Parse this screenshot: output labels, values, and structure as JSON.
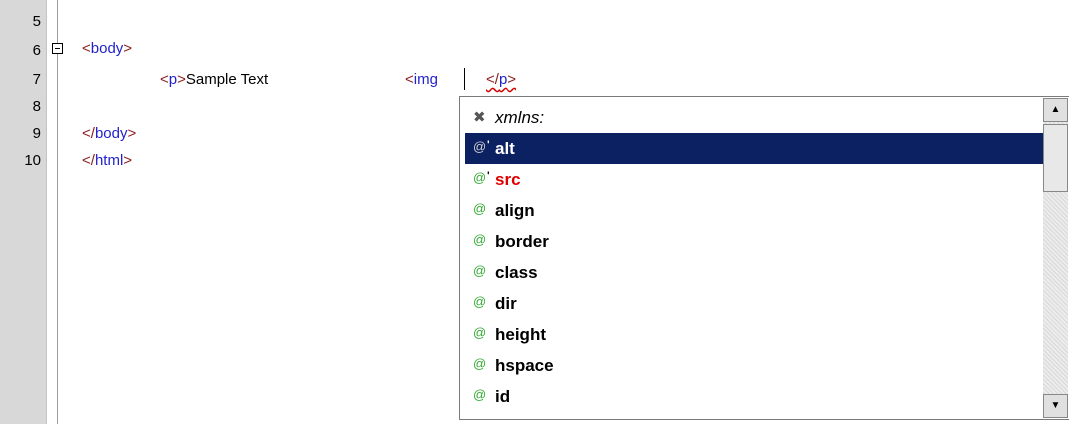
{
  "editor": {
    "line_numbers": [
      "5",
      "6",
      "7",
      "8",
      "9",
      "10"
    ],
    "lines": {
      "line6": {
        "open": "<",
        "tag": "body",
        "close": ">"
      },
      "line7": {
        "p_open": "<",
        "p_tag": "p",
        "p_close": ">",
        "text": "Sample Text",
        "img_open": "<",
        "img_tag": "img",
        "endp_open": "</",
        "endp_tag": "p",
        "endp_close": ">"
      },
      "line9": {
        "open": "</",
        "tag": "body",
        "close": ">"
      },
      "line10": {
        "open": "</",
        "tag": "html",
        "close": ">"
      }
    },
    "fold_icon": "collapse-box-icon"
  },
  "completion": {
    "selected_index": 1,
    "items": [
      {
        "label": "xmlns:",
        "icon": "namespace-icon",
        "kind": "namespace"
      },
      {
        "label": "alt",
        "icon": "attribute-icon",
        "kind": "required"
      },
      {
        "label": "src",
        "icon": "attribute-icon",
        "kind": "required"
      },
      {
        "label": "align",
        "icon": "attribute-icon",
        "kind": "attribute"
      },
      {
        "label": "border",
        "icon": "attribute-icon",
        "kind": "attribute"
      },
      {
        "label": "class",
        "icon": "attribute-icon",
        "kind": "attribute"
      },
      {
        "label": "dir",
        "icon": "attribute-icon",
        "kind": "attribute"
      },
      {
        "label": "height",
        "icon": "attribute-icon",
        "kind": "attribute"
      },
      {
        "label": "hspace",
        "icon": "attribute-icon",
        "kind": "attribute"
      },
      {
        "label": "id",
        "icon": "attribute-icon",
        "kind": "attribute"
      }
    ],
    "scrollbar": {
      "up": "▲",
      "down": "▼"
    }
  }
}
